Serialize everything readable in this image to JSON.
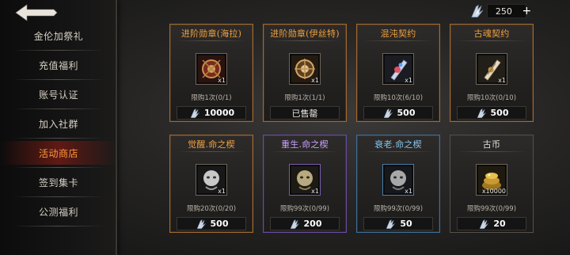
{
  "sidebar": {
    "back_icon": "back-arrow-icon",
    "items": [
      {
        "label": "金伦加祭礼",
        "active": false
      },
      {
        "label": "充值福利",
        "active": false
      },
      {
        "label": "账号认证",
        "active": false
      },
      {
        "label": "加入社群",
        "active": false
      },
      {
        "label": "活动商店",
        "active": true
      },
      {
        "label": "签到集卡",
        "active": false
      },
      {
        "label": "公测福利",
        "active": false
      }
    ]
  },
  "currency": {
    "icon": "crystal-shard-icon",
    "amount": "250",
    "plus_label": "+"
  },
  "shop": {
    "items": [
      {
        "title": "进阶勋章(海拉)",
        "qty": "x1",
        "limit": "限购1次(0/1)",
        "price": "10000",
        "sold_out": false,
        "rarity": "orange",
        "icon": "medal-hela-icon"
      },
      {
        "title": "进阶勋章(伊丝特)",
        "qty": "x1",
        "limit": "限购1次(1/1)",
        "price": "已售罄",
        "sold_out": true,
        "rarity": "orange",
        "icon": "medal-ister-icon"
      },
      {
        "title": "混沌契约",
        "qty": "x1",
        "limit": "限购10次(6/10)",
        "price": "500",
        "sold_out": false,
        "rarity": "orange",
        "icon": "chaos-contract-scroll-icon"
      },
      {
        "title": "古魂契约",
        "qty": "x1",
        "limit": "限购10次(0/10)",
        "price": "500",
        "sold_out": false,
        "rarity": "orange",
        "icon": "ancient-soul-contract-scroll-icon"
      },
      {
        "title": "觉醒.命之楔",
        "qty": "x1",
        "limit": "限购20次(0/20)",
        "price": "500",
        "sold_out": false,
        "rarity": "orange",
        "icon": "awakening-wedge-icon"
      },
      {
        "title": "重生.命之楔",
        "qty": "x1",
        "limit": "限购99次(0/99)",
        "price": "200",
        "sold_out": false,
        "rarity": "purple",
        "icon": "rebirth-wedge-icon"
      },
      {
        "title": "衰老.命之楔",
        "qty": "x1",
        "limit": "限购99次(0/99)",
        "price": "50",
        "sold_out": false,
        "rarity": "blue",
        "icon": "decay-wedge-icon"
      },
      {
        "title": "古币",
        "qty": "x10000",
        "limit": "限购99次(0/99)",
        "price": "20",
        "sold_out": false,
        "rarity": "gray",
        "icon": "ancient-coin-pile-icon"
      }
    ]
  },
  "colors": {
    "accent_orange": "#f0a040",
    "active_menu": "#ff9a3a",
    "purple": "#c8a0ff",
    "blue": "#86c4ee"
  }
}
